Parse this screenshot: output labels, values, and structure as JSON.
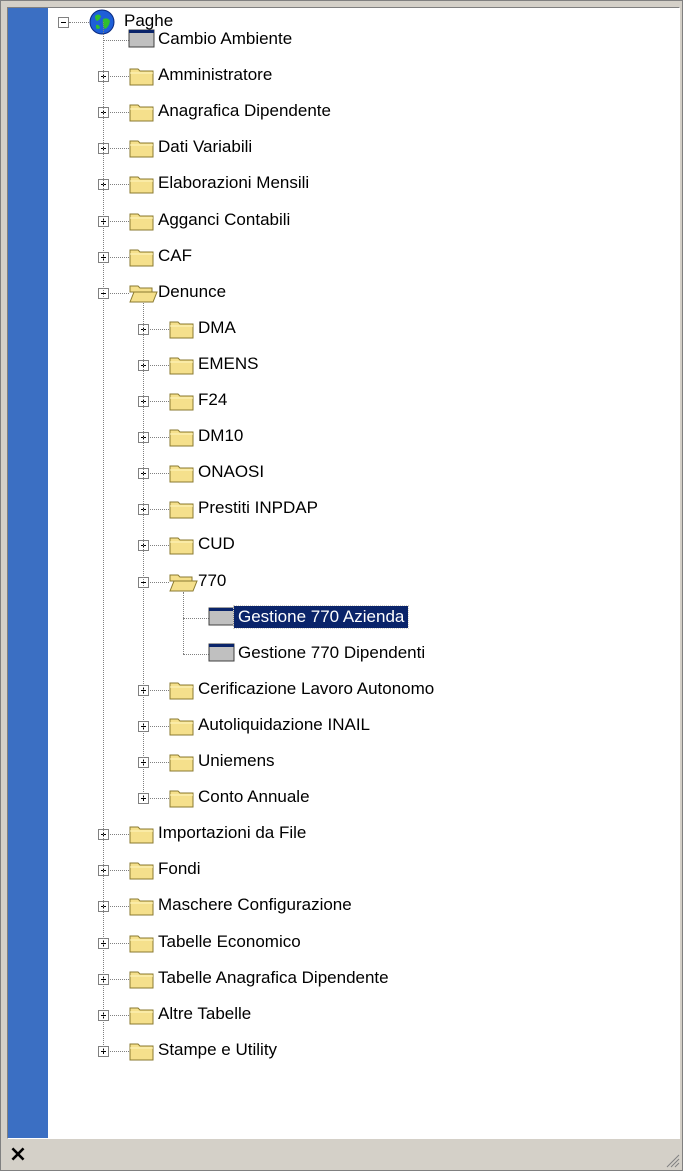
{
  "tree": {
    "root": {
      "label": "Paghe",
      "icon": "globe-icon"
    },
    "items": [
      {
        "label": "Cambio Ambiente",
        "icon": "form-icon"
      },
      {
        "label": "Amministratore",
        "icon": "folder-icon"
      },
      {
        "label": "Anagrafica Dipendente",
        "icon": "folder-icon"
      },
      {
        "label": "Dati Variabili",
        "icon": "folder-icon"
      },
      {
        "label": "Elaborazioni Mensili",
        "icon": "folder-icon"
      },
      {
        "label": "Agganci Contabili",
        "icon": "folder-icon"
      },
      {
        "label": "CAF",
        "icon": "folder-icon"
      },
      {
        "label": "Denunce",
        "icon": "folder-open-icon"
      },
      {
        "label": "DMA",
        "icon": "folder-icon"
      },
      {
        "label": "EMENS",
        "icon": "folder-icon"
      },
      {
        "label": "F24",
        "icon": "folder-icon"
      },
      {
        "label": "DM10",
        "icon": "folder-icon"
      },
      {
        "label": "ONAOSI",
        "icon": "folder-icon"
      },
      {
        "label": "Prestiti INPDAP",
        "icon": "folder-icon"
      },
      {
        "label": "CUD",
        "icon": "folder-icon"
      },
      {
        "label": "770",
        "icon": "folder-open-icon"
      },
      {
        "label": "Gestione 770 Azienda",
        "icon": "form-icon",
        "selected": true
      },
      {
        "label": "Gestione 770 Dipendenti",
        "icon": "form-icon"
      },
      {
        "label": "Cerificazione Lavoro Autonomo",
        "icon": "folder-icon"
      },
      {
        "label": "Autoliquidazione INAIL",
        "icon": "folder-icon"
      },
      {
        "label": "Uniemens",
        "icon": "folder-icon"
      },
      {
        "label": "Conto Annuale",
        "icon": "folder-icon"
      },
      {
        "label": "Importazioni da File",
        "icon": "folder-icon"
      },
      {
        "label": "Fondi",
        "icon": "folder-icon"
      },
      {
        "label": "Maschere Configurazione",
        "icon": "folder-icon"
      },
      {
        "label": "Tabelle Economico",
        "icon": "folder-icon"
      },
      {
        "label": "Tabelle Anagrafica Dipendente",
        "icon": "folder-icon"
      },
      {
        "label": "Altre Tabelle",
        "icon": "folder-icon"
      },
      {
        "label": "Stampe e Utility",
        "icon": "folder-icon"
      }
    ]
  },
  "footer": {
    "close_label": "×"
  },
  "colors": {
    "selection": "#0a246a",
    "strip": "#3b6fc3",
    "folder": "#f5e08c"
  }
}
